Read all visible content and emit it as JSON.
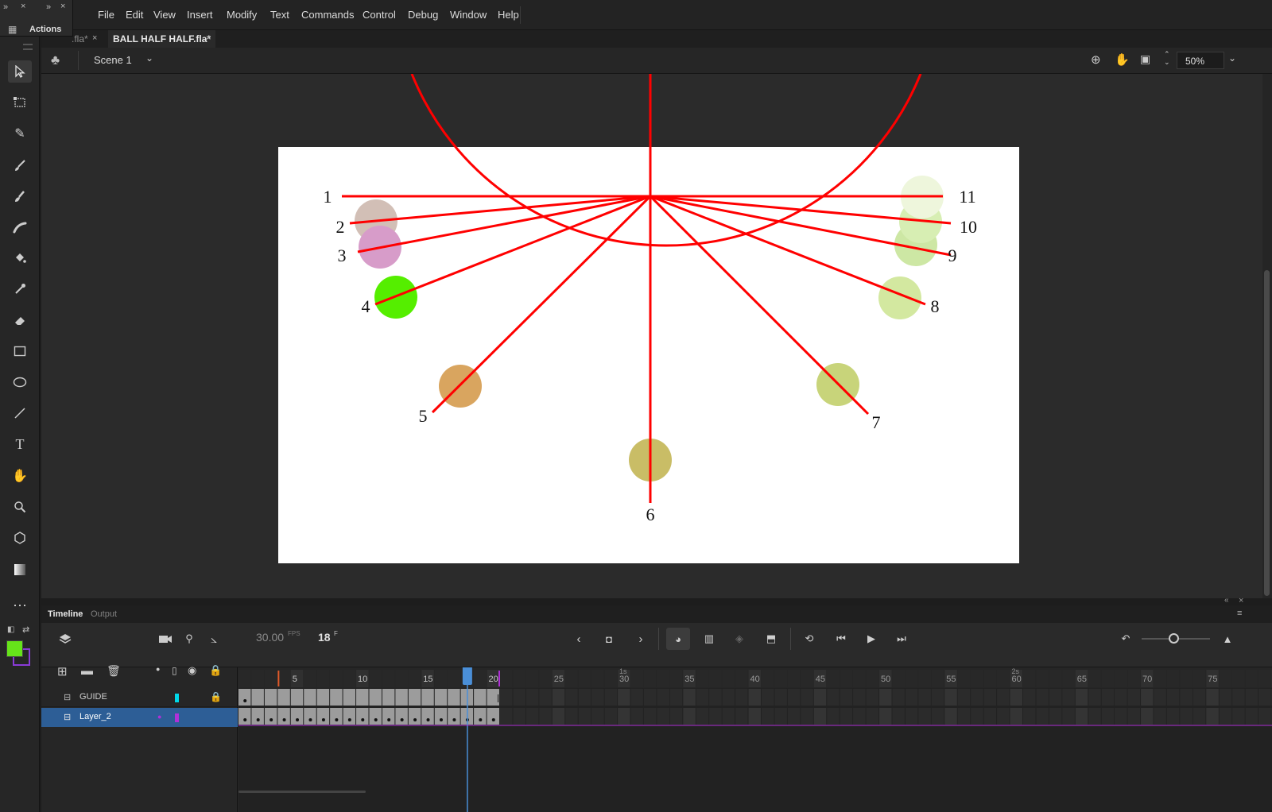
{
  "menu": [
    "File",
    "Edit",
    "View",
    "Insert",
    "Modify",
    "Text",
    "Commands",
    "Control",
    "Debug",
    "Window",
    "Help"
  ],
  "panel_label": "Actions",
  "tabs": [
    {
      "label": ".fla*",
      "active": false
    },
    {
      "label": "BALL HALF HALF.fla*",
      "active": true
    }
  ],
  "scene": "Scene 1",
  "zoom": "50%",
  "stage": {
    "labels": [
      "1",
      "2",
      "3",
      "4",
      "5",
      "6",
      "7",
      "8",
      "9",
      "10",
      "11"
    ],
    "colors": {
      "guide": "#ff0000",
      "stage_bg": "#ffffff",
      "pasteboard": "#2b2b2b"
    },
    "balls": [
      "#d2bfb6",
      "#d79cc9",
      "#55ee00",
      "#d9a55f",
      "#c9bd66",
      "#c8d47a",
      "#d3e8a0",
      "#cde7a4",
      "#d7eeb3",
      "#eef6dc"
    ]
  },
  "timeline": {
    "tabs": [
      "Timeline",
      "Output"
    ],
    "fps": "30.00",
    "fps_unit": "FPS",
    "current_frame": "18",
    "frame_unit": "F",
    "time_markers": [
      "1s",
      "2s"
    ],
    "frame_numbers": [
      "5",
      "10",
      "15",
      "20",
      "25",
      "30",
      "35",
      "40",
      "45",
      "50",
      "55",
      "60",
      "65",
      "70",
      "75"
    ],
    "layers": [
      {
        "name": "GUIDE",
        "color": "#00d8e8",
        "locked": true,
        "selected": false
      },
      {
        "name": "Layer_2",
        "color": "#b030d8",
        "locked": false,
        "selected": true
      }
    ]
  },
  "colors": {
    "fill": "#66e31a",
    "accent_blue": "#4a8fd8",
    "selection_row": "#2d5e96"
  }
}
